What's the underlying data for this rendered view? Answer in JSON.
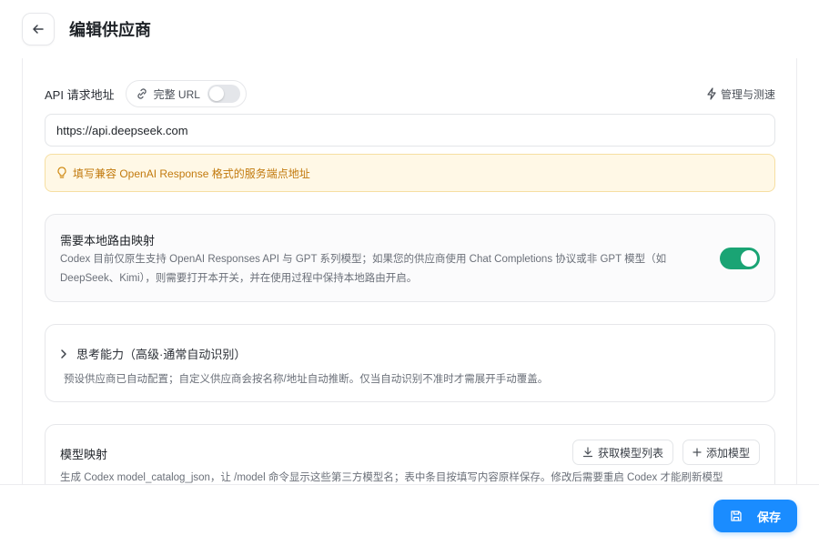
{
  "header": {
    "title": "编辑供应商"
  },
  "api": {
    "label": "API 请求地址",
    "full_url_label": "完整 URL",
    "full_url_enabled": false,
    "manage_label": "管理与测速",
    "url_value": "https://api.deepseek.com",
    "hint": "填写兼容 OpenAI Response 格式的服务端点地址"
  },
  "local_routing": {
    "title": "需要本地路由映射",
    "desc_line1": "Codex 目前仅原生支持 OpenAI Responses API 与 GPT 系列模型；如果您的供应商使用 Chat Completions 协议或非 GPT 模型（如",
    "desc_line2": "DeepSeek、Kimi），则需要打开本开关，并在使用过程中保持本地路由开启。",
    "enabled": true
  },
  "thinking": {
    "title": "思考能力（高级·通常自动识别）",
    "desc": "预设供应商已自动配置；自定义供应商会按名称/地址自动推断。仅当自动识别不准时才需展开手动覆盖。"
  },
  "model_mapping": {
    "title": "模型映射",
    "fetch_label": "获取模型列表",
    "add_label": "添加模型",
    "desc": "生成 Codex model_catalog_json，让 /model 命令显示这些第三方模型名；表中条目按填写内容原样保存。修改后需要重启 Codex 才能刷新模型"
  },
  "footer": {
    "save_label": "保存"
  },
  "colors": {
    "accent": "#1a8cff",
    "toggle_on": "#1aa474",
    "hint_text": "#c27a0e",
    "hint_bg": "#fff8e6"
  }
}
